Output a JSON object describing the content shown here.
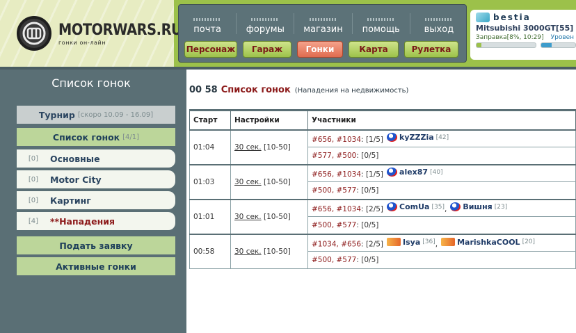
{
  "header": {
    "logo_name": "MOTORWARS.RU",
    "logo_tagline": "гонки он-лайн",
    "menu": [
      "почта",
      "форумы",
      "магазин",
      "помощь",
      "выход"
    ],
    "buttons": [
      "Персонаж",
      "Гараж",
      "Гонки",
      "Карта",
      "Рулетка"
    ],
    "active_button": "Гонки",
    "user": {
      "name": "bestia",
      "car": "Mitsubishi 3000GT[55]",
      "fuel_label": "Заправка[8%, 10:29]",
      "level_label": "Уровен",
      "fuel_fraction": 0.08,
      "level_fraction": 0.3
    }
  },
  "sidebar": {
    "title": "Список гонок",
    "tournament": {
      "label": "Турнир",
      "sub": "[скоро 10.09 - 16.09]"
    },
    "race_list": {
      "label": "Список гонок",
      "sub": "[4/1]"
    },
    "categories": [
      {
        "count": "[0]",
        "label": "Основные"
      },
      {
        "count": "[0]",
        "label": "Motor City"
      },
      {
        "count": "[0]",
        "label": "Картинг"
      },
      {
        "count": "[4]",
        "label": "**Нападения"
      }
    ],
    "submit": "Подать заявку",
    "active": "Активные гонки"
  },
  "content": {
    "time": "00 58",
    "title": "Список гонок",
    "note": "(Нападения на недвижимость)",
    "columns": [
      "Старт",
      "Настройки",
      "Участники"
    ],
    "rows": [
      {
        "start": "01:04",
        "settings_link": "30 сек.",
        "settings_rest": "[10-50]",
        "lines": [
          {
            "refs": "#656, #1034",
            "slots": "[1/5]",
            "players": [
              {
                "name": "kyZZZia",
                "lvl": "[42]",
                "icon": "flag"
              }
            ]
          },
          {
            "refs": "#577, #500",
            "slots": "[0/5]",
            "players": []
          }
        ]
      },
      {
        "start": "01:03",
        "settings_link": "30 сек.",
        "settings_rest": "[10-50]",
        "lines": [
          {
            "refs": "#656, #1034",
            "slots": "[1/5]",
            "players": [
              {
                "name": "alex87",
                "lvl": "[40]",
                "icon": "flag"
              }
            ]
          },
          {
            "refs": "#500, #577",
            "slots": "[0/5]",
            "players": []
          }
        ]
      },
      {
        "start": "01:01",
        "settings_link": "30 сек.",
        "settings_rest": "[10-50]",
        "lines": [
          {
            "refs": "#656, #1034",
            "slots": "[2/5]",
            "players": [
              {
                "name": "ComUa",
                "lvl": "[35]",
                "icon": "flag"
              },
              {
                "name": "Вишня",
                "lvl": "[23]",
                "icon": "flag"
              }
            ]
          },
          {
            "refs": "#500, #577",
            "slots": "[0/5]",
            "players": []
          }
        ]
      },
      {
        "start": "00:58",
        "settings_link": "30 сек.",
        "settings_rest": "[10-50]",
        "lines": [
          {
            "refs": "#1034, #656",
            "slots": "[2/5]",
            "players": [
              {
                "name": "Isya",
                "lvl": "[36]",
                "icon": "flame"
              },
              {
                "name": "MarishkaCOOL",
                "lvl": "[20]",
                "icon": "flame"
              }
            ]
          },
          {
            "refs": "#500, #577",
            "slots": "[0/5]",
            "players": []
          }
        ]
      }
    ]
  }
}
